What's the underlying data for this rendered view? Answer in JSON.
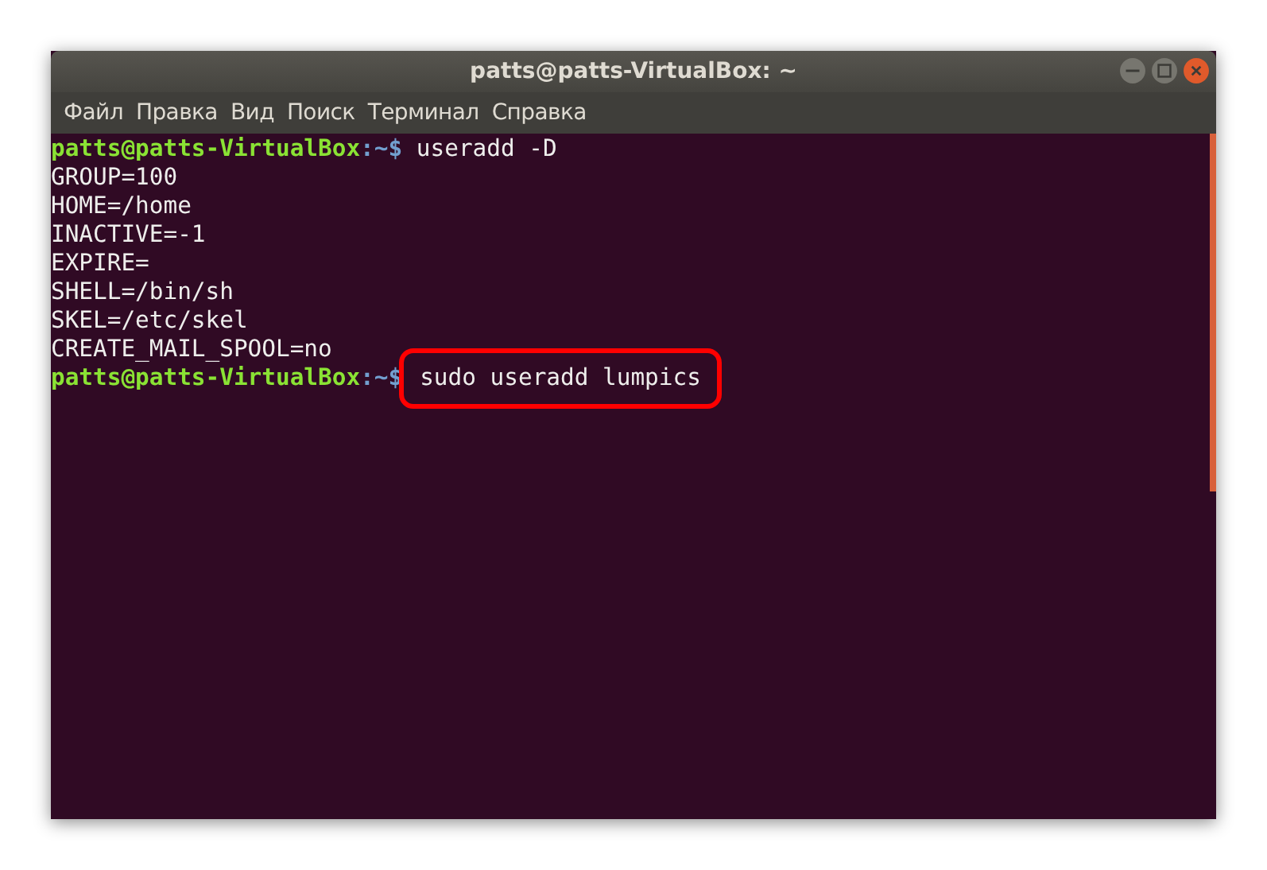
{
  "window": {
    "title": "patts@patts-VirtualBox: ~"
  },
  "menu": [
    "Файл",
    "Правка",
    "Вид",
    "Поиск",
    "Терминал",
    "Справка"
  ],
  "lines": [
    {
      "kind": "prompt",
      "prompt": "patts@patts-VirtualBox",
      "path": ":~$",
      "command": "useradd -D",
      "highlighted": false
    },
    {
      "kind": "output",
      "text": "GROUP=100"
    },
    {
      "kind": "output",
      "text": "HOME=/home"
    },
    {
      "kind": "output",
      "text": "INACTIVE=-1"
    },
    {
      "kind": "output",
      "text": "EXPIRE="
    },
    {
      "kind": "output",
      "text": "SHELL=/bin/sh"
    },
    {
      "kind": "output",
      "text": "SKEL=/etc/skel"
    },
    {
      "kind": "output",
      "text": "CREATE_MAIL_SPOOL=no"
    },
    {
      "kind": "prompt",
      "prompt": "patts@patts-VirtualBox",
      "path": ":~$",
      "command": "sudo useradd lumpics",
      "highlighted": true
    }
  ]
}
